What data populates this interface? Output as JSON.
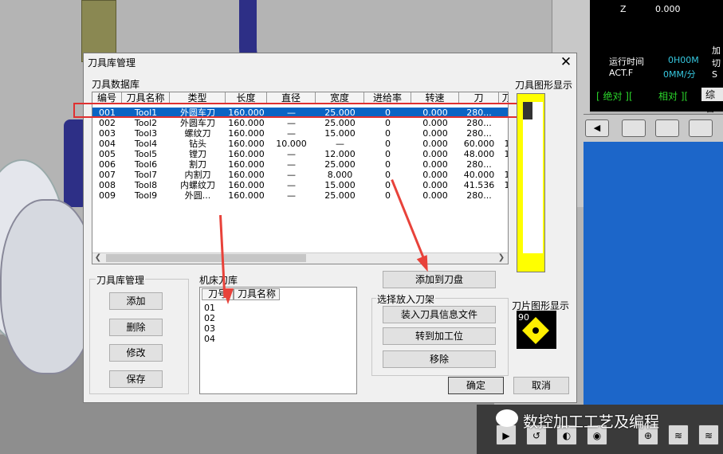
{
  "background": {
    "panel": {
      "z_label": "Z",
      "z_value": "0.000",
      "run_time_label": "运行时间",
      "run_time_value": "0H00M",
      "actf_label": "ACT.F",
      "actf_value": "0MM/分",
      "side_1": "加",
      "side_2": "切",
      "side_3": "S",
      "mode_abs": "[ 绝对 ][",
      "mode_rel": "相对 ][",
      "mode_sum": "综合"
    },
    "watermark": "数控加工工艺及编程"
  },
  "dialog": {
    "title": "刀具库管理",
    "close_glyph": "✕",
    "tool_db_label": "刀具数据库",
    "table": {
      "headers": [
        "编号",
        "刀具名称",
        "类型",
        "长度",
        "直径",
        "宽度",
        "进给率",
        "转速",
        "刀",
        "刀"
      ],
      "rows": [
        [
          "001",
          "Tool1",
          "外圆车刀",
          "160.000",
          "—",
          "25.000",
          "0",
          "0.000",
          "280...",
          ""
        ],
        [
          "002",
          "Tool2",
          "外圆车刀",
          "160.000",
          "—",
          "25.000",
          "0",
          "0.000",
          "280...",
          ""
        ],
        [
          "003",
          "Tool3",
          "螺纹刀",
          "160.000",
          "—",
          "15.000",
          "0",
          "0.000",
          "280...",
          ""
        ],
        [
          "004",
          "Tool4",
          "钻头",
          "160.000",
          "10.000",
          "—",
          "0",
          "0.000",
          "60.000",
          "1"
        ],
        [
          "005",
          "Tool5",
          "镗刀",
          "160.000",
          "—",
          "12.000",
          "0",
          "0.000",
          "48.000",
          "1"
        ],
        [
          "006",
          "Tool6",
          "割刀",
          "160.000",
          "—",
          "25.000",
          "0",
          "0.000",
          "280...",
          ""
        ],
        [
          "007",
          "Tool7",
          "内割刀",
          "160.000",
          "—",
          "8.000",
          "0",
          "0.000",
          "40.000",
          "1"
        ],
        [
          "008",
          "Tool8",
          "内螺纹刀",
          "160.000",
          "—",
          "15.000",
          "0",
          "0.000",
          "41.536",
          "1"
        ],
        [
          "009",
          "Tool9",
          "外圆...",
          "160.000",
          "—",
          "25.000",
          "0",
          "0.000",
          "280...",
          ""
        ]
      ]
    },
    "tool_graphic_label": "刀具图形显示",
    "insert_graphic_label": "刀片图形显示",
    "insert_angle": "90",
    "lib_group_label": "刀具库管理",
    "btn_add": "添加",
    "btn_delete": "删除",
    "btn_modify": "修改",
    "btn_save": "保存",
    "machine_lib_label": "机床刀库",
    "machine_headers": [
      "刀号",
      "刀具名称"
    ],
    "machine_items": [
      "01",
      "02",
      "03",
      "04"
    ],
    "btn_add_to_turret": "添加到刀盘",
    "holder_group_label": "选择放入刀架",
    "btn_load_info": "装入刀具信息文件",
    "btn_to_position": "转到加工位",
    "btn_remove": "移除",
    "btn_ok": "确定",
    "btn_cancel": "取消"
  }
}
